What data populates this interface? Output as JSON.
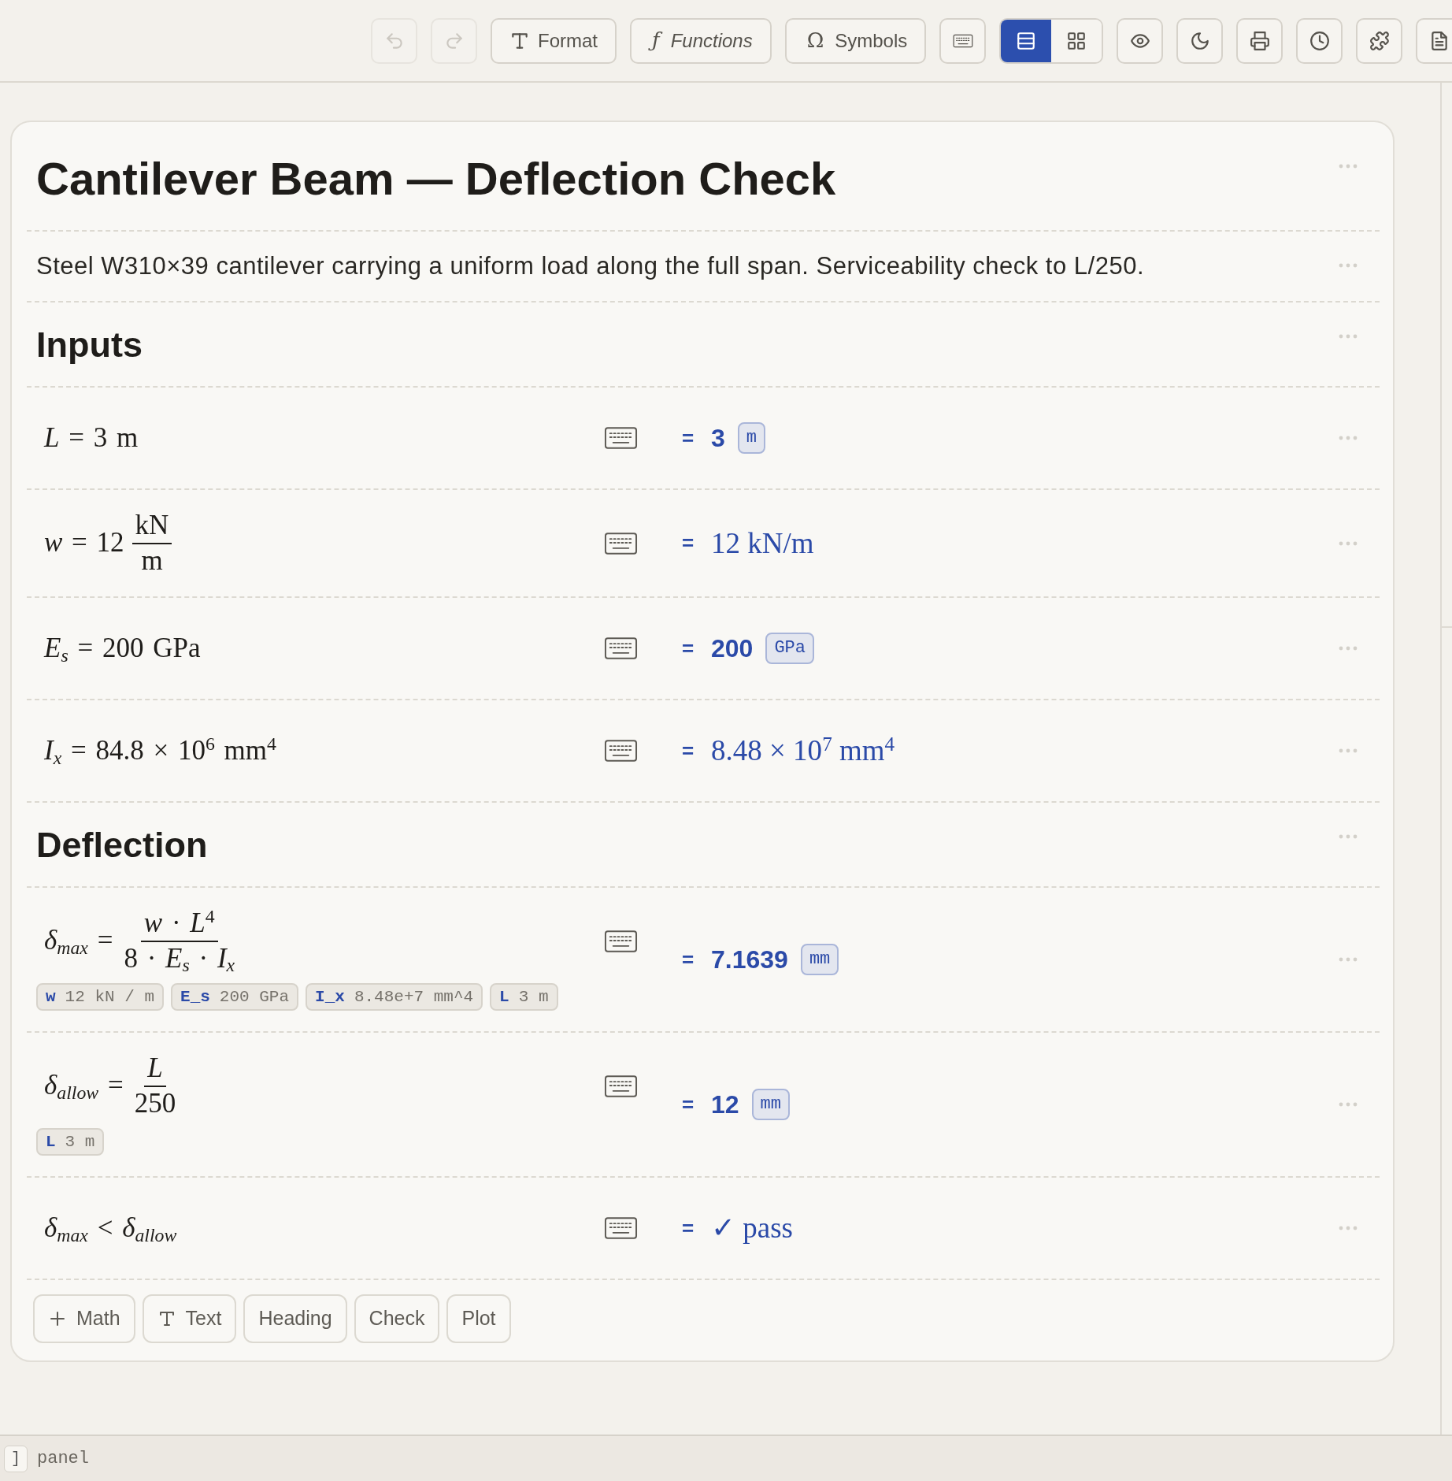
{
  "toolbar": [
    {
      "kind": "undo",
      "disabled": true
    },
    {
      "kind": "redo",
      "disabled": true
    },
    {
      "kind": "format",
      "label": "Format",
      "disabled": false
    },
    {
      "kind": "functions",
      "glyph": "ƒ",
      "label": "Functions",
      "disabled": false
    },
    {
      "kind": "symbols",
      "glyph": "Ω",
      "label": "Symbols",
      "disabled": false
    },
    {
      "kind": "keyboard",
      "disabled": false
    },
    {
      "kind": "view_toggle",
      "disabled": false,
      "options": [
        {
          "kind": "list",
          "selected": true
        },
        {
          "kind": "grid",
          "selected": false
        }
      ]
    },
    {
      "kind": "preview",
      "disabled": false
    },
    {
      "kind": "theme",
      "disabled": false
    },
    {
      "kind": "print",
      "disabled": false
    },
    {
      "kind": "history",
      "disabled": false
    },
    {
      "kind": "plugins",
      "disabled": false
    },
    {
      "kind": "document",
      "disabled": false
    }
  ],
  "document": {
    "blocks": [
      {
        "kind": "title",
        "text": "Cantilever Beam — Deflection Check"
      },
      {
        "kind": "paragraph",
        "text": "Steel W310×39 cantilever carrying a uniform load along the full span. Serviceability check to L/250."
      },
      {
        "kind": "heading",
        "text": "Inputs"
      },
      {
        "kind": "math",
        "formula": [
          {
            "kind": "text",
            "text": "*L* = 3 m"
          }
        ],
        "result": {
          "sign": "=",
          "kind": "number",
          "value": "3",
          "unit": "m"
        }
      },
      {
        "kind": "math",
        "formula": [
          {
            "kind": "text",
            "text": "*w* = 12"
          },
          {
            "kind": "frac",
            "num": "kN",
            "den": "m"
          }
        ],
        "result": {
          "sign": "=",
          "kind": "math",
          "text": "12 kN/m"
        }
      },
      {
        "kind": "math",
        "formula": [
          {
            "kind": "text",
            "text": "*E*$_{s}$ = 200 GPa"
          }
        ],
        "result": {
          "sign": "=",
          "kind": "number",
          "value": "200",
          "unit": "GPa"
        }
      },
      {
        "kind": "math",
        "formula": [
          {
            "kind": "text",
            "text": "*I*$_{x}$ = 84.8 × 10$^{6}$ mm$^{4}$"
          }
        ],
        "result": {
          "sign": "=",
          "kind": "math",
          "text": "8.48 × 10$^{7}$ mm$^{4}$"
        }
      },
      {
        "kind": "heading",
        "text": "Deflection"
      },
      {
        "kind": "math",
        "formula": [
          {
            "kind": "text",
            "text": "*δ*$_{max}$ ="
          },
          {
            "kind": "frac",
            "num": "*w* · *L*$^{4}$",
            "den": "8 · *E*$_{s}$ · *I*$_{x}$"
          }
        ],
        "chips": [
          {
            "name": "w",
            "value": "12 kN / m"
          },
          {
            "name": "E_s",
            "value": "200 GPa"
          },
          {
            "name": "I_x",
            "value": "8.48e+7 mm^4"
          },
          {
            "name": "L",
            "value": "3 m"
          }
        ],
        "result": {
          "sign": "=",
          "kind": "number",
          "value": "7.1639",
          "unit": "mm"
        }
      },
      {
        "kind": "math",
        "formula": [
          {
            "kind": "text",
            "text": "*δ*$_{allow}$ ="
          },
          {
            "kind": "frac",
            "num": "*L*",
            "den": "250"
          }
        ],
        "chips": [
          {
            "name": "L",
            "value": "3 m"
          }
        ],
        "result": {
          "sign": "=",
          "kind": "number",
          "value": "12",
          "unit": "mm"
        }
      },
      {
        "kind": "math",
        "formula": [
          {
            "kind": "text",
            "text": "*δ*$_{max}$ < *δ*$_{allow}$"
          }
        ],
        "result": {
          "sign": "=",
          "kind": "math",
          "text": "✓ pass"
        }
      }
    ],
    "add_buttons": [
      {
        "kind": "math",
        "label": "Math"
      },
      {
        "kind": "text",
        "label": "Text"
      },
      {
        "kind": "heading",
        "label": "Heading"
      },
      {
        "kind": "check",
        "label": "Check"
      },
      {
        "kind": "plot",
        "label": "Plot"
      }
    ]
  },
  "status_bar": {
    "key": "]",
    "label": "panel"
  }
}
